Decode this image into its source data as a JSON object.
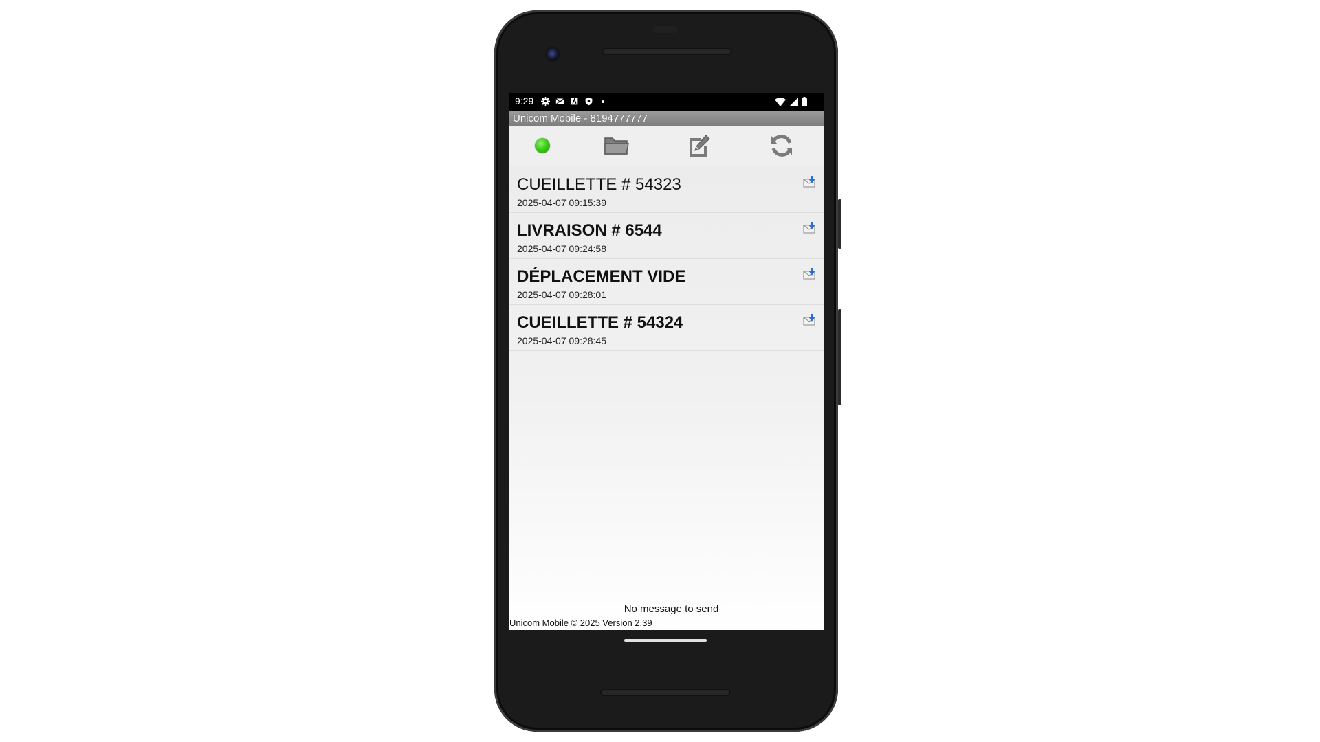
{
  "statusbar": {
    "time": "9:29",
    "left_icons": [
      "gear-icon",
      "mail-icon",
      "a-box-icon",
      "shield-icon"
    ],
    "right_icons": [
      "wifi-icon",
      "cell-signal-icon",
      "battery-icon"
    ]
  },
  "app": {
    "title": "Unicom Mobile - 8194777777",
    "toolbar": {
      "status_color": "#3fcb1c",
      "buttons": [
        "status-indicator",
        "folder-icon",
        "compose-icon",
        "refresh-icon"
      ]
    },
    "messages": [
      {
        "title": "CUEILLETTE # 54323",
        "timestamp": "2025-04-07 09:15:39",
        "bold": false,
        "icon": "download-envelope-icon"
      },
      {
        "title": "LIVRAISON # 6544",
        "timestamp": "2025-04-07 09:24:58",
        "bold": true,
        "icon": "download-envelope-icon"
      },
      {
        "title": "DÉPLACEMENT VIDE",
        "timestamp": "2025-04-07 09:28:01",
        "bold": true,
        "icon": "download-envelope-icon"
      },
      {
        "title": "CUEILLETTE # 54324",
        "timestamp": "2025-04-07 09:28:45",
        "bold": true,
        "icon": "download-envelope-icon"
      }
    ],
    "footer_status": "No message to send",
    "footer_copyright": "Unicom Mobile © 2025 Version 2.39"
  }
}
